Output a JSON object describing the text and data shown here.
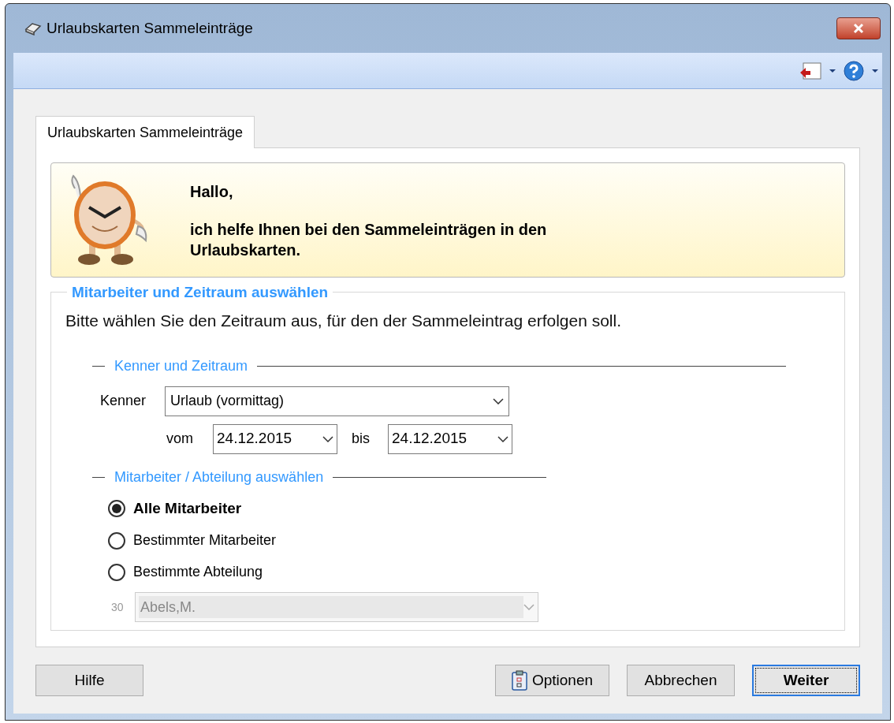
{
  "window": {
    "title": "Urlaubskarten Sammeleinträge"
  },
  "tabs": [
    {
      "label": "Urlaubskarten Sammeleinträge",
      "selected": true
    }
  ],
  "info": {
    "greeting": "Hallo,",
    "message": "ich helfe Ihnen bei den Sammeleinträgen in den Urlaubskarten."
  },
  "group": {
    "title": "Mitarbeiter und Zeitraum auswählen",
    "instruction": "Bitte wählen Sie den Zeitraum aus, für den der Sammeleintrag erfolgen soll.",
    "period_section": {
      "title": "Kenner und Zeitraum",
      "kenner_label": "Kenner",
      "kenner_value": "Urlaub (vormittag)",
      "from_label": "vom",
      "from_value": "24.12.2015",
      "to_label": "bis",
      "to_value": "24.12.2015"
    },
    "employee_section": {
      "title": "Mitarbeiter / Abteilung auswählen",
      "options": [
        {
          "label": "Alle Mitarbeiter",
          "selected": true
        },
        {
          "label": "Bestimmter Mitarbeiter",
          "selected": false
        },
        {
          "label": "Bestimmte Abteilung",
          "selected": false
        }
      ],
      "employee_number": "30",
      "employee_value": "Abels,M.",
      "employee_disabled": true
    }
  },
  "buttons": [
    {
      "label": "Hilfe",
      "kind": "plain",
      "default": false
    },
    {
      "label": "Optionen",
      "kind": "icon",
      "default": false
    },
    {
      "label": "Abbrechen",
      "kind": "plain",
      "default": false
    },
    {
      "label": "Weiter",
      "kind": "plain",
      "default": true
    }
  ]
}
